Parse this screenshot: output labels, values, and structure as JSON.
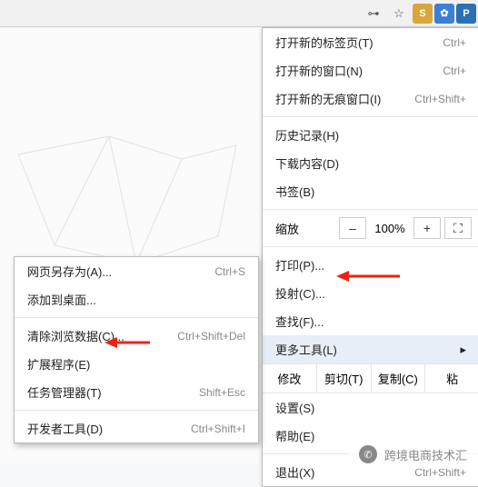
{
  "toolbar": {
    "key_icon": "⊶",
    "star_icon": "☆",
    "ext1_label": "S",
    "ext1_color": "#d8a63a",
    "ext2_label": "✿",
    "ext2_color": "#3b7fd6",
    "ext3_label": "P",
    "ext3_color": "#2d6fb5"
  },
  "main_menu": {
    "new_tab": {
      "label": "打开新的标签页(T)",
      "shortcut": "Ctrl+"
    },
    "new_window": {
      "label": "打开新的窗口(N)",
      "shortcut": "Ctrl+"
    },
    "incognito": {
      "label": "打开新的无痕窗口(I)",
      "shortcut": "Ctrl+Shift+"
    },
    "history": {
      "label": "历史记录(H)"
    },
    "downloads": {
      "label": "下载内容(D)"
    },
    "bookmarks": {
      "label": "书签(B)"
    },
    "zoom": {
      "label": "缩放",
      "minus": "–",
      "value": "100%",
      "plus": "+"
    },
    "print": {
      "label": "打印(P)..."
    },
    "cast": {
      "label": "投射(C)..."
    },
    "find": {
      "label": "查找(F)..."
    },
    "more_tools": {
      "label": "更多工具(L)"
    },
    "edit_row": {
      "edit": "修改",
      "cut": "剪切(T)",
      "copy": "复制(C)",
      "paste": "粘"
    },
    "settings": {
      "label": "设置(S)"
    },
    "help": {
      "label": "帮助(E)"
    },
    "exit": {
      "label": "退出(X)",
      "shortcut": "Ctrl+Shift+"
    }
  },
  "sub_menu": {
    "save_as": {
      "label": "网页另存为(A)...",
      "shortcut": "Ctrl+S"
    },
    "add_desktop": {
      "label": "添加到桌面..."
    },
    "clear_data": {
      "label": "清除浏览数据(C)...",
      "shortcut": "Ctrl+Shift+Del"
    },
    "extensions": {
      "label": "扩展程序(E)"
    },
    "task_mgr": {
      "label": "任务管理器(T)",
      "shortcut": "Shift+Esc"
    },
    "dev_tools": {
      "label": "开发者工具(D)",
      "shortcut": "Ctrl+Shift+I"
    }
  },
  "watermark": {
    "text": "跨境电商技术汇"
  }
}
